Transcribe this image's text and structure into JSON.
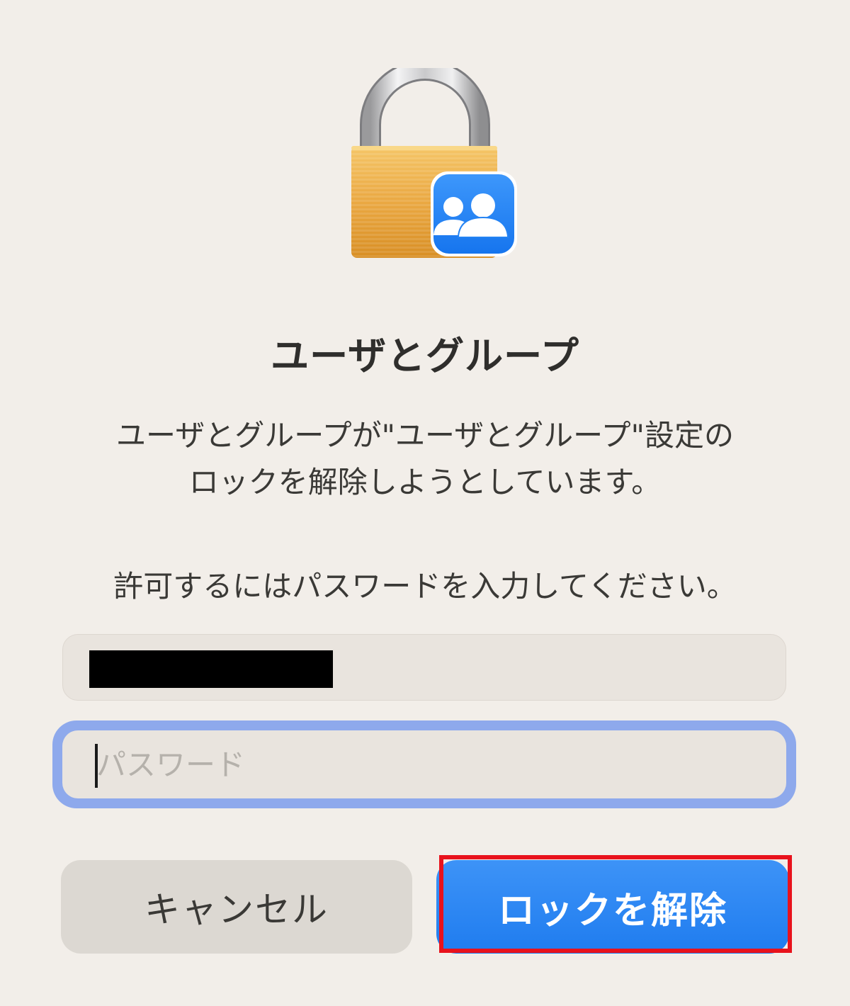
{
  "dialog": {
    "icon": "lock-with-users-icon",
    "title": "ユーザとグループ",
    "message_line1": "ユーザとグループが\"ユーザとグループ\"設定の",
    "message_line2": "ロックを解除しようとしています。",
    "prompt": "許可するにはパスワードを入力してください。",
    "username_field": {
      "value_redacted": true
    },
    "password_field": {
      "placeholder": "パスワード",
      "value": "",
      "focused": true
    },
    "buttons": {
      "cancel_label": "キャンセル",
      "unlock_label": "ロックを解除"
    },
    "colors": {
      "accent": "#1f7cef",
      "focus_ring": "#8ea9ec",
      "highlight_annotation": "#e8121c"
    }
  }
}
